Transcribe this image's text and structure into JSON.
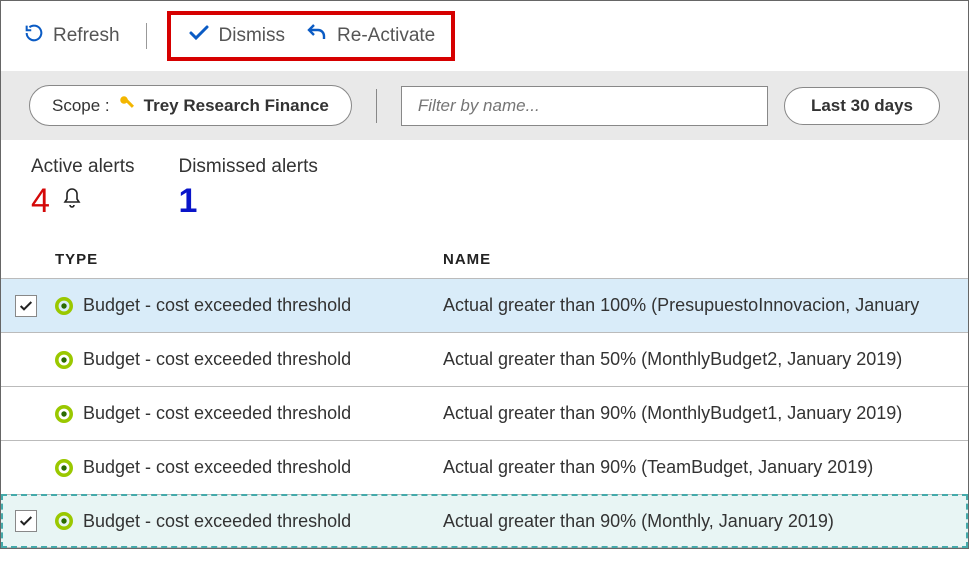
{
  "toolbar": {
    "refresh_label": "Refresh",
    "dismiss_label": "Dismiss",
    "reactivate_label": "Re-Activate"
  },
  "filter": {
    "scope_prefix": "Scope :",
    "scope_name": "Trey Research Finance",
    "placeholder": "Filter by name...",
    "range_label": "Last 30 days"
  },
  "counters": {
    "active_label": "Active alerts",
    "active_count": "4",
    "dismissed_label": "Dismissed alerts",
    "dismissed_count": "1"
  },
  "columns": {
    "type": "TYPE",
    "name": "NAME"
  },
  "rows": [
    {
      "selected": true,
      "focused": false,
      "type": "Budget - cost exceeded threshold",
      "name": "Actual greater than 100% (PresupuestoInnovacion, January "
    },
    {
      "selected": false,
      "focused": false,
      "type": "Budget - cost exceeded threshold",
      "name": "Actual greater than 50% (MonthlyBudget2, January 2019)"
    },
    {
      "selected": false,
      "focused": false,
      "type": "Budget - cost exceeded threshold",
      "name": "Actual greater than 90% (MonthlyBudget1, January 2019)"
    },
    {
      "selected": false,
      "focused": false,
      "type": "Budget - cost exceeded threshold",
      "name": "Actual greater than 90% (TeamBudget, January 2019)"
    },
    {
      "selected": true,
      "focused": true,
      "type": "Budget - cost exceeded threshold",
      "name": "Actual greater than 90% (Monthly, January 2019)"
    }
  ]
}
